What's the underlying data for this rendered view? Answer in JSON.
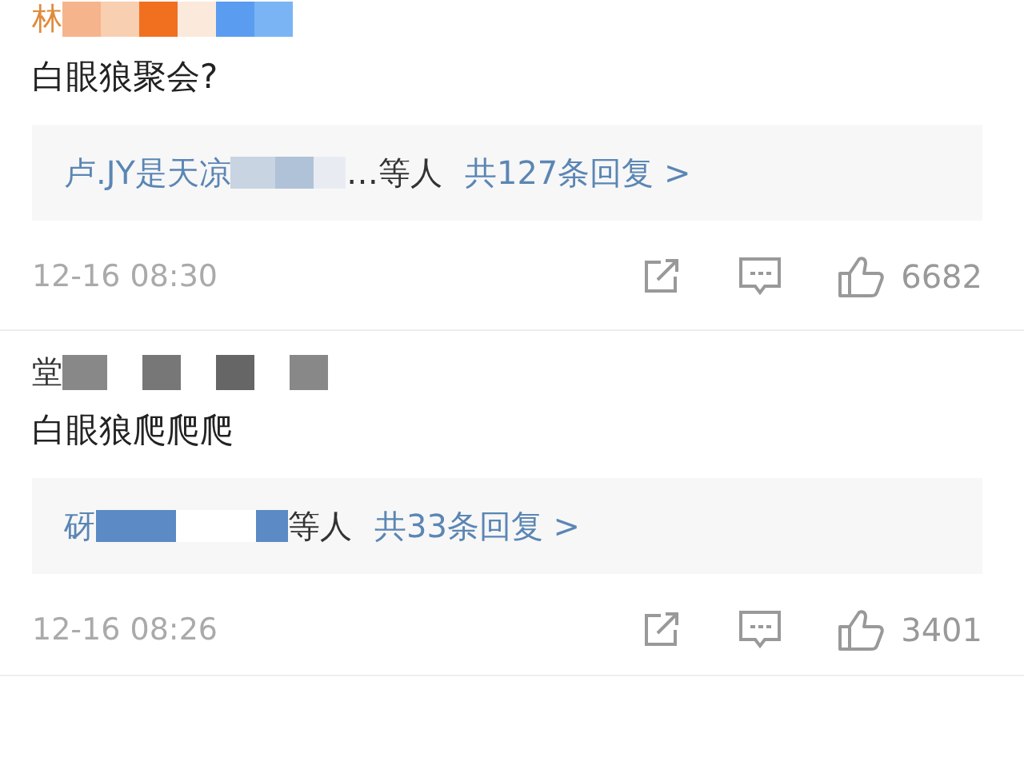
{
  "comments": [
    {
      "author": "林",
      "text": "白眼狼聚会?",
      "replies": {
        "names": "卢.JY是天凉",
        "suffix": "…等人",
        "count": "共127条回复 >"
      },
      "time": "12-16 08:30",
      "likes": "6682"
    },
    {
      "author": "堂",
      "text": "白眼狼爬爬爬",
      "replies": {
        "names": "砑",
        "suffix": "等人",
        "count": "共33条回复 >"
      },
      "time": "12-16 08:26",
      "likes": "3401"
    }
  ]
}
